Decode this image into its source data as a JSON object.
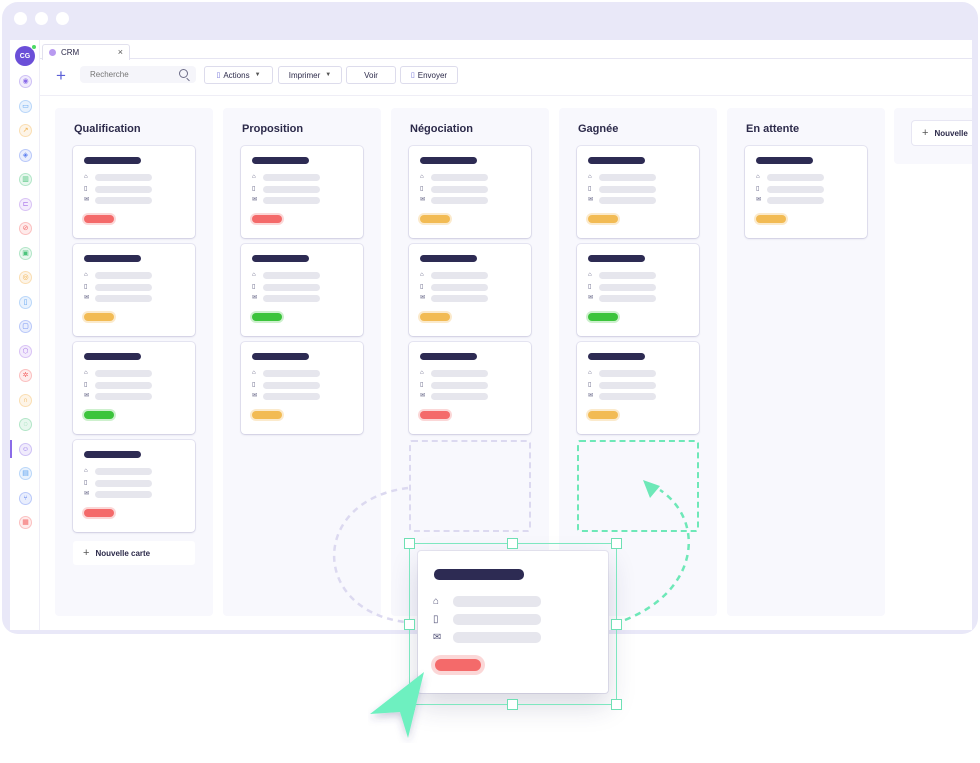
{
  "window": {
    "avatar_initials": "CG"
  },
  "tab": {
    "label": "CRM",
    "close": "×"
  },
  "toolbar": {
    "add_label": "+",
    "search_placeholder": "Recherche",
    "actions_label": "Actions",
    "print_label": "Imprimer",
    "view_label": "Voir",
    "send_label": "Envoyer"
  },
  "sidebar": {
    "icons": [
      "users-icon",
      "folder-icon",
      "trend-icon",
      "signal-icon",
      "chart-icon",
      "cart-icon",
      "ban-icon",
      "inbox-icon",
      "coin-icon",
      "clipboard-icon",
      "screen-icon",
      "box-icon",
      "gear-icon",
      "headset-icon",
      "chat-icon",
      "contact-icon",
      "building-icon",
      "branch-icon",
      "calendar-icon"
    ],
    "colors": [
      "#8b6ce8",
      "#5aa0f0",
      "#f2b04a",
      "#5b7ff0",
      "#4cc47c",
      "#a56ee8",
      "#f46a6a",
      "#4cc47c",
      "#f2b04a",
      "#5aa0f0",
      "#5b7ff0",
      "#a56ee8",
      "#f46a6a",
      "#f2b04a",
      "#4cc47c",
      "#8b6ce8",
      "#5aa0f0",
      "#5b7ff0",
      "#f46a6a"
    ]
  },
  "board": {
    "new_card_label": "Nouvelle carte",
    "new_column_label": "Nouvelle",
    "columns": [
      {
        "title": "Qualification",
        "tags": [
          "red",
          "orange",
          "green",
          "red"
        ]
      },
      {
        "title": "Proposition",
        "tags": [
          "red",
          "green",
          "orange"
        ]
      },
      {
        "title": "Négociation",
        "tags": [
          "orange",
          "orange",
          "red"
        ]
      },
      {
        "title": "Gagnée",
        "tags": [
          "orange",
          "green",
          "orange"
        ]
      },
      {
        "title": "En attente",
        "tags": [
          "orange"
        ]
      }
    ]
  },
  "colors": {
    "accent": "#5b5fd6",
    "drag_green": "#6ee8b8",
    "red": "#f46a6a",
    "orange": "#f2bb54",
    "green": "#3cc43c"
  }
}
